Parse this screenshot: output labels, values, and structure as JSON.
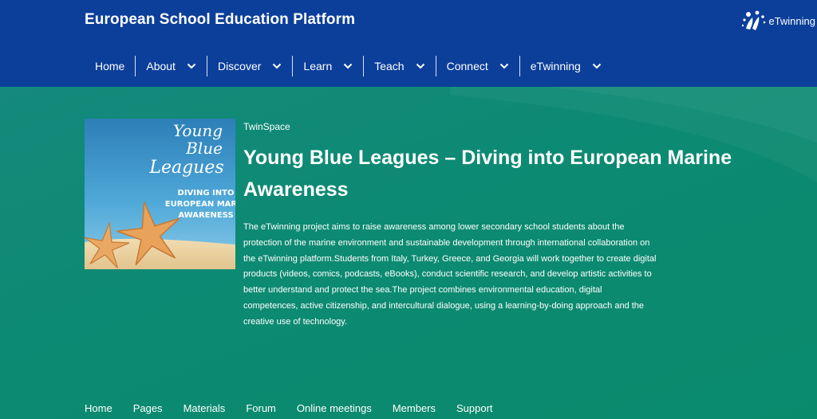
{
  "header": {
    "site_title": "European School Education Platform",
    "brand_label": "eTwinning",
    "brand_icon": "etwinning-logo-icon"
  },
  "main_nav": {
    "items": [
      {
        "label": "Home",
        "has_dropdown": false
      },
      {
        "label": "About",
        "has_dropdown": true
      },
      {
        "label": "Discover",
        "has_dropdown": true
      },
      {
        "label": "Learn",
        "has_dropdown": true
      },
      {
        "label": "Teach",
        "has_dropdown": true
      },
      {
        "label": "Connect",
        "has_dropdown": true
      },
      {
        "label": "eTwinning",
        "has_dropdown": true
      }
    ]
  },
  "project": {
    "eyebrow": "TwinSpace",
    "title": "Young Blue Leagues – Diving into European Marine Awareness",
    "description": "The eTwinning project aims to raise awareness among lower secondary school students about the protection of the marine environment and sustainable development through international collaboration on the eTwinning platform.Students from Italy, Turkey, Greece, and Georgia will work together to create digital products (videos, comics, podcasts, eBooks), conduct scientific research, and develop artistic activities to better understand and protect the sea.The project combines environmental education, digital competences, active citizenship, and intercultural dialogue, using a learning-by-doing approach and the creative use of technology.",
    "image": {
      "script_title_line1": "Young",
      "script_title_line2": "Blue",
      "script_title_line3": "Leagues",
      "caption_line1": "DIVING INTO",
      "caption_line2": "EUROPEAN MARIN",
      "caption_line3": "AWARENESS"
    }
  },
  "sub_nav": {
    "items": [
      "Home",
      "Pages",
      "Materials",
      "Forum",
      "Online meetings",
      "Members",
      "Support"
    ]
  },
  "colors": {
    "header_bg": "#0c3f9a",
    "hero_bg": "#0c8a74",
    "text": "#ffffff"
  }
}
